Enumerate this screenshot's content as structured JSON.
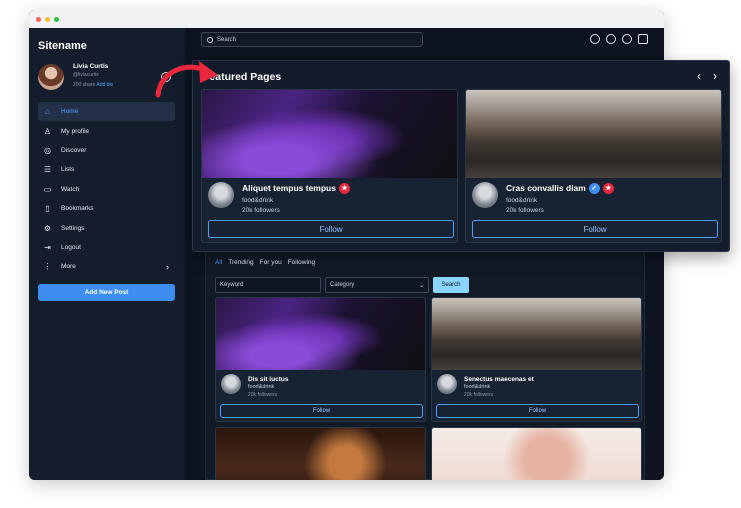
{
  "window": {
    "dots": [
      "#ff5f57",
      "#febc2e",
      "#28c840"
    ]
  },
  "sidebar": {
    "brand": "Sitename",
    "user": {
      "name": "Livia Curtis",
      "handle": "@liviacurtis",
      "stats": "200 share",
      "link": "Add bio"
    },
    "items": [
      {
        "label": "Home",
        "icon": "home-icon",
        "glyph": "⌂",
        "active": true
      },
      {
        "label": "My profile",
        "icon": "user-icon",
        "glyph": "♙"
      },
      {
        "label": "Discover",
        "icon": "compass-icon",
        "glyph": "◎"
      },
      {
        "label": "Lists",
        "icon": "list-icon",
        "glyph": "☰"
      },
      {
        "label": "Watch",
        "icon": "video-icon",
        "glyph": "▭"
      },
      {
        "label": "Bookmarks",
        "icon": "bookmark-icon",
        "glyph": "▯"
      },
      {
        "label": "Settings",
        "icon": "gear-icon",
        "glyph": "⚙"
      },
      {
        "label": "Logout",
        "icon": "logout-icon",
        "glyph": "⇥"
      },
      {
        "label": "More",
        "icon": "more-icon",
        "glyph": "⋮",
        "chevron": "›"
      }
    ],
    "new_post": "Add New Post"
  },
  "topbar": {
    "search_placeholder": "Search",
    "icons": [
      "compass-icon",
      "chat-icon",
      "bell-icon",
      "add-icon"
    ]
  },
  "featured": {
    "title": "Featured Pages",
    "prev": "‹",
    "next": "›",
    "cards": [
      {
        "name": "Aliquet tempus tempus",
        "category": "food&drink",
        "followers": "20k followers",
        "button": "Follow",
        "verified": false,
        "hot": true
      },
      {
        "name": "Cras convallis diam",
        "category": "food&drink",
        "followers": "20k followers",
        "button": "Follow",
        "verified": true,
        "hot": true
      }
    ]
  },
  "feed": {
    "tabs": [
      "All",
      "Trending",
      "For you",
      "Following"
    ],
    "keyword_placeholder": "Keyword",
    "category_placeholder": "Category",
    "search_button": "Search",
    "cards": [
      {
        "name": "Dis sit luctus",
        "category": "food&drink",
        "followers": "20k followers",
        "button": "Follow"
      },
      {
        "name": "Senectus maecenas et",
        "category": "food&drink",
        "followers": "20k followers",
        "button": "Follow"
      }
    ]
  },
  "colors": {
    "accent": "#3d8ef0",
    "link": "#4aa3ff",
    "arrow": "#e8273a",
    "bg": "#0d1420"
  }
}
